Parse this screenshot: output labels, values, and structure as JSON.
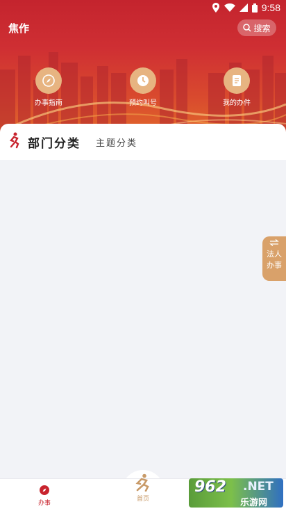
{
  "status_bar": {
    "time": "9:58"
  },
  "header": {
    "title": "焦作",
    "search_label": "搜索"
  },
  "quick_actions": [
    {
      "label": "办事指南",
      "icon": "compass-icon"
    },
    {
      "label": "预约叫号",
      "icon": "clock-icon"
    },
    {
      "label": "我的办件",
      "icon": "document-icon"
    }
  ],
  "category_tabs": {
    "active": "部门分类",
    "inactive": "主题分类"
  },
  "side_float": {
    "line1": "法人",
    "line2": "办事",
    "icon": "swap-arrows-icon"
  },
  "bottom_nav": {
    "items": [
      {
        "label": "办事",
        "icon": "compass-icon",
        "active": true
      },
      {
        "label": "首页",
        "icon": "runner-logo-icon",
        "active": false
      }
    ]
  },
  "watermark": {
    "top": "962",
    "net": ".NET",
    "bottom": "乐游网"
  },
  "colors": {
    "primary_red": "#c8232d",
    "accent_gold": "#d9a16a",
    "background": "#f2f3f7"
  }
}
